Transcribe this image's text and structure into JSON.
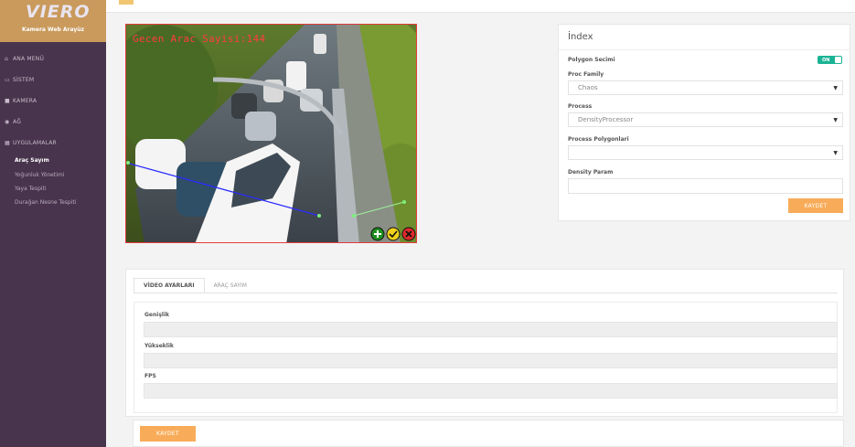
{
  "brand": {
    "logo": "VIERO",
    "subtitle": "Kamera Web Arayüz"
  },
  "sidebar": {
    "items": [
      {
        "label": "ANA MENÜ",
        "icon": "home-icon"
      },
      {
        "label": "SİSTEM",
        "icon": "monitor-icon"
      },
      {
        "label": "KAMERA",
        "icon": "video-camera-icon"
      },
      {
        "label": "AĞ",
        "icon": "globe-icon"
      },
      {
        "label": "UYGULAMALAR",
        "icon": "document-icon"
      }
    ],
    "subitems": [
      {
        "label": "Araç Sayım",
        "active": true
      },
      {
        "label": "Yoğunluk Yönetimi",
        "active": false
      },
      {
        "label": "Yaya Tespiti",
        "active": false
      },
      {
        "label": "Durağan Nesne Tespiti",
        "active": false
      }
    ]
  },
  "camera": {
    "overlay_text": "Gecen Arac Sayisi:144"
  },
  "index_panel": {
    "title": "İndex",
    "polygon_label": "Polygon Secimi",
    "toggle_label": "ON",
    "proc_family_label": "Proc Family",
    "proc_family_value": "Chaos",
    "process_label": "Process",
    "process_value": "DensityProcessor",
    "polygons_label": "Process Polygonlari",
    "polygons_value": "",
    "density_label": "Density Param",
    "save_label": "KAYDET"
  },
  "bottom": {
    "tabs": [
      {
        "label": "VİDEO AYARLARI",
        "active": true
      },
      {
        "label": "ARAÇ SAYIM",
        "active": false
      }
    ],
    "fields": [
      {
        "label": "Genişlik"
      },
      {
        "label": "Yükseklik"
      },
      {
        "label": "FPS"
      }
    ],
    "save_label": "KAYDET"
  },
  "colors": {
    "sidebar": "#48344c",
    "accent": "#f8ac59",
    "toggle": "#1ab394",
    "logo_bg": "#c99a5c"
  }
}
